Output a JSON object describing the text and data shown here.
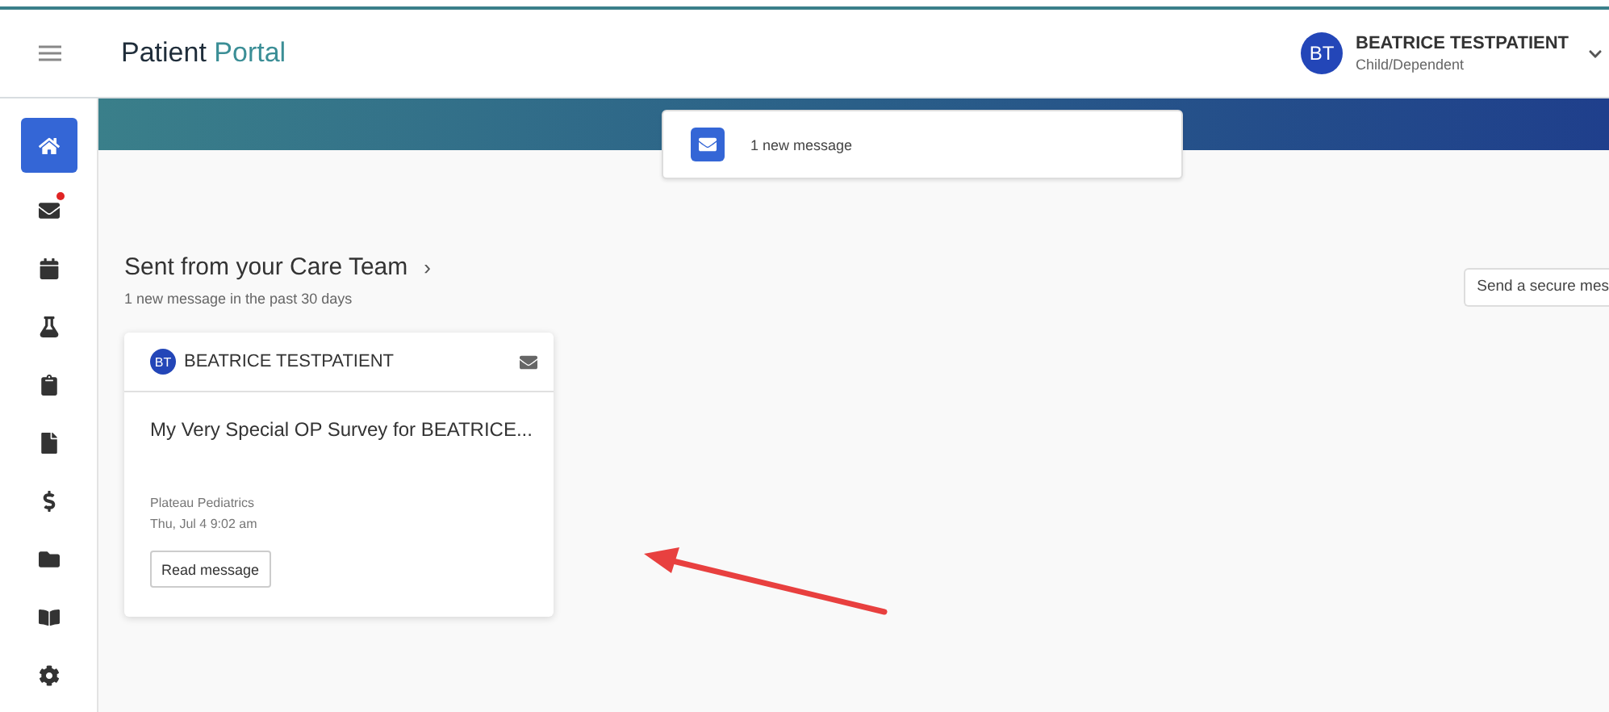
{
  "header": {
    "title_main": "Patient",
    "title_accent": "Portal",
    "user": {
      "initials": "BT",
      "name": "BEATRICE TESTPATIENT",
      "role": "Child/Dependent"
    }
  },
  "sidebar": {
    "items": [
      {
        "selected": true,
        "unread": false
      },
      {
        "selected": false,
        "unread": true
      },
      {
        "selected": false,
        "unread": false
      },
      {
        "selected": false,
        "unread": false
      },
      {
        "selected": false,
        "unread": false
      },
      {
        "selected": false,
        "unread": false
      },
      {
        "selected": false,
        "unread": false
      },
      {
        "selected": false,
        "unread": false
      },
      {
        "selected": false,
        "unread": false
      },
      {
        "selected": false,
        "unread": false
      }
    ]
  },
  "notification": {
    "text": "1 new message"
  },
  "section": {
    "title": "Sent from your Care Team",
    "chevron": "›",
    "subtitle": "1 new message in the past 30 days",
    "action": "Send a secure mes"
  },
  "message_card": {
    "initials": "BT",
    "sender": "BEATRICE TESTPATIENT",
    "subject": "My Very Special OP Survey for BEATRICE...",
    "clinic": "Plateau Pediatrics",
    "date": "Thu, Jul 4 9:02 am",
    "button": "Read message"
  }
}
